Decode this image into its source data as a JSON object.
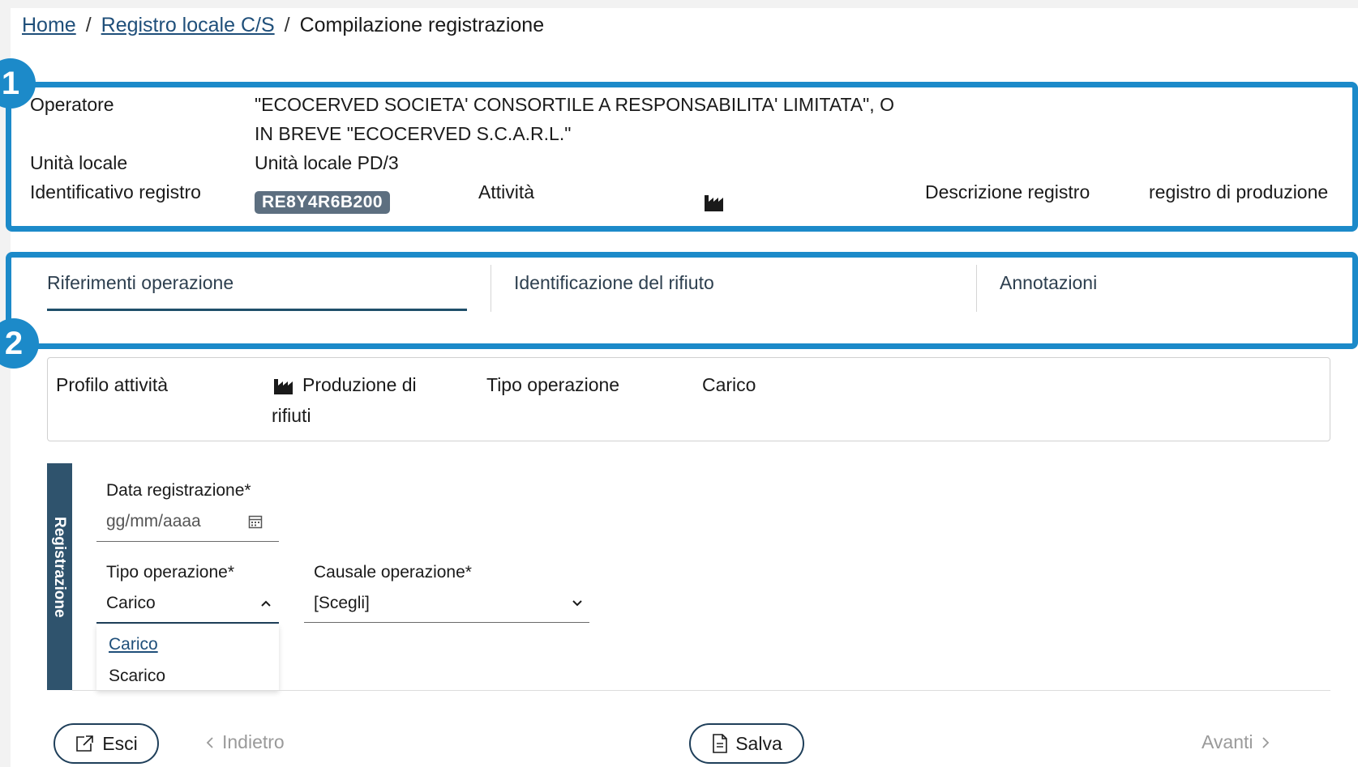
{
  "breadcrumb": {
    "home": "Home",
    "registry": "Registro locale C/S",
    "current": "Compilazione registrazione",
    "separator": "/"
  },
  "callouts": [
    "1",
    "2"
  ],
  "info": {
    "operatore_label": "Operatore",
    "operatore_value_line1": "\"ECOCERVED SOCIETA' CONSORTILE A RESPONSABILITA' LIMITATA\", O",
    "operatore_value_line2": "IN BREVE \"ECOCERVED S.C.A.R.L.\"",
    "unita_label": "Unità locale",
    "unita_value": "Unità locale PD/3",
    "id_label": "Identificativo registro",
    "id_value": "RE8Y4R6B200",
    "attivita_label": "Attività",
    "attivita_icon": "factory-icon",
    "descrizione_label": "Descrizione registro",
    "descrizione_value": "registro di produzione"
  },
  "tabs": [
    {
      "label": "Riferimenti operazione",
      "active": true
    },
    {
      "label": "Identificazione del rifiuto",
      "active": false
    },
    {
      "label": "Annotazioni",
      "active": false
    }
  ],
  "profile": {
    "profilo_label": "Profilo attività",
    "profilo_value_line1": "Produzione di",
    "profilo_value_line2": "rifiuti",
    "tipo_label": "Tipo operazione",
    "tipo_value": "Carico"
  },
  "registration": {
    "section_title": "Registrazione",
    "data_label": "Data registrazione*",
    "data_placeholder": "gg/mm/aaaa",
    "tipo_label": "Tipo operazione*",
    "tipo_value": "Carico",
    "causale_label": "Causale operazione*",
    "causale_value": "[Scegli]",
    "tipo_options": [
      "Carico",
      "Scarico"
    ]
  },
  "buttons": {
    "esci": "Esci",
    "indietro": "Indietro",
    "salva": "Salva",
    "avanti": "Avanti"
  },
  "colors": {
    "accent": "#1c8ac9",
    "dark_blue": "#2f536d",
    "chip": "#5d6f80"
  }
}
